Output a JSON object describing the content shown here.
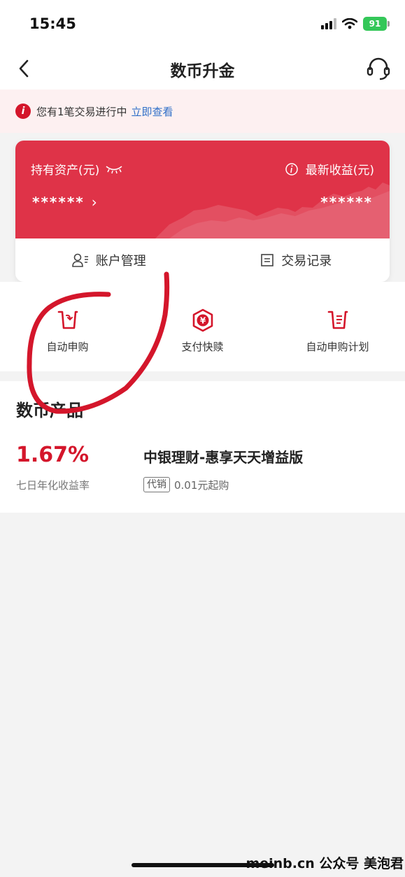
{
  "status_bar": {
    "time": "15:45",
    "battery": "91"
  },
  "nav": {
    "title": "数币升金",
    "back_icon": "chevron-left-icon",
    "service_icon": "headset-icon"
  },
  "notice": {
    "text": "您有1笔交易进行中",
    "link": "立即查看",
    "icon": "alert-icon"
  },
  "asset_card": {
    "asset_label": "持有资产(元)",
    "asset_value": "******",
    "profit_label": "最新收益(元)",
    "profit_value": "******",
    "accent_color": "#df3348",
    "actions": [
      {
        "label": "账户管理",
        "icon": "account-manage-icon"
      },
      {
        "label": "交易记录",
        "icon": "record-icon"
      }
    ]
  },
  "quick_menu": [
    {
      "label": "自动申购",
      "icon": "auto-purchase-icon"
    },
    {
      "label": "支付快赎",
      "icon": "quick-redeem-icon"
    },
    {
      "label": "自动申购计划",
      "icon": "purchase-plan-icon"
    }
  ],
  "products": {
    "section_title": "数币产品",
    "items": [
      {
        "rate": "1.67%",
        "rate_label": "七日年化收益率",
        "name": "中银理财-惠享天天增益版",
        "tag": "代销",
        "min_purchase": "0.01元起购"
      }
    ]
  },
  "watermark": "meinb.cn  公众号 美泡君"
}
